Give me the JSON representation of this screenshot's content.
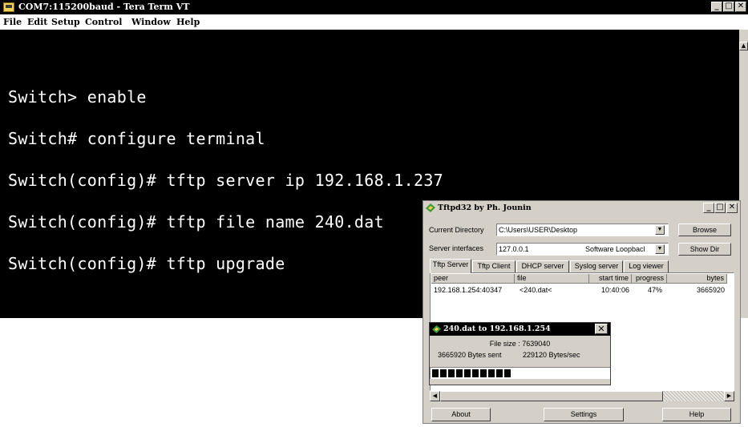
{
  "teraterm": {
    "title": "COM7:115200baud - Tera Term VT",
    "menu": [
      "File",
      "Edit",
      "Setup",
      "Control",
      "Window",
      "Help"
    ],
    "lines": [
      "Switch> enable",
      "Switch# configure terminal",
      "Switch(config)# tftp server ip 192.168.1.237",
      "Switch(config)# tftp file name 240.dat",
      "Switch(config)# tftp upgrade"
    ]
  },
  "tftpd": {
    "title": "Tftpd32 by Ph. Jounin",
    "current_directory_label": "Current Directory",
    "current_directory": "C:\\Users\\USER\\Desktop",
    "server_interfaces_label": "Server interfaces",
    "server_ip": "127.0.0.1",
    "server_iface": "Software Loopbacl",
    "browse_label": "Browse",
    "showdir_label": "Show Dir",
    "tabs": [
      "Tftp Server",
      "Tftp Client",
      "DHCP server",
      "Syslog server",
      "Log viewer"
    ],
    "columns": [
      "peer",
      "file",
      "start time",
      "progress",
      "bytes"
    ],
    "rows": [
      {
        "peer": "192.168.1.254:40347",
        "file": "<240.dat<",
        "start_time": "10:40:06",
        "progress": "47%",
        "bytes": "3665920"
      }
    ],
    "buttons": {
      "about": "About",
      "settings": "Settings",
      "help": "Help"
    }
  },
  "transfer": {
    "title": "240.dat to 192.168.1.254",
    "file_size": "File size : 7639040",
    "bytes_sent": "3665920 Bytes sent",
    "rate": "229120 Bytes/sec",
    "progress": 0.47
  }
}
